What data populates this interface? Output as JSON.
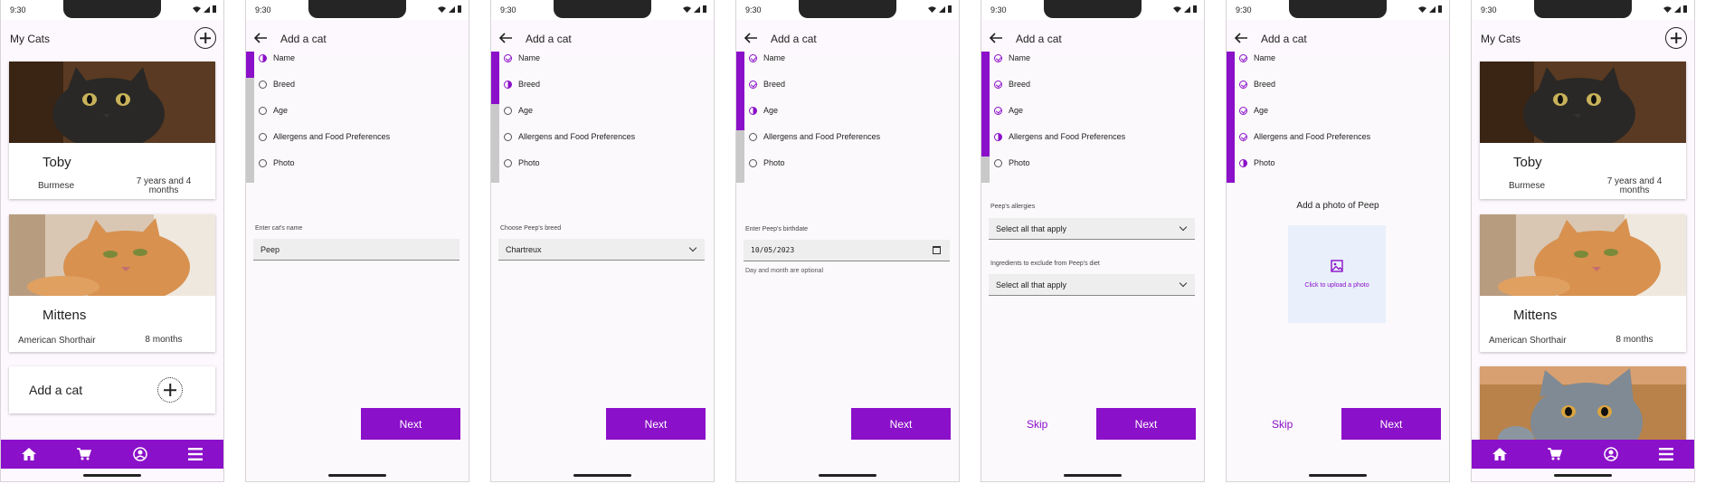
{
  "status": {
    "time": "9:30"
  },
  "colors": {
    "accent": "#8b10c9",
    "nav_bg": "#8b10c9",
    "rail_inactive": "#c9c9c9"
  },
  "list_title": "My Cats",
  "form_title": "Add a cat",
  "cats": [
    {
      "name": "Toby",
      "breed": "Burmese",
      "age": "7 years and 4 months"
    },
    {
      "name": "Mittens",
      "breed": "American Shorthair",
      "age": "8 months"
    }
  ],
  "add_cat_label": "Add a cat",
  "steps": [
    "Name",
    "Breed",
    "Age",
    "Allergens and Food Preferences",
    "Photo"
  ],
  "forms": {
    "name": {
      "label": "Enter cat's name",
      "value": "Peep"
    },
    "breed": {
      "label": "Choose Peep's breed",
      "value": "Chartreux"
    },
    "age": {
      "label": "Enter Peep's birthdate",
      "value": "10/05/2023",
      "hint": "Day and month are optional"
    },
    "allergies": {
      "label": "Peep's allergies",
      "value": "Select all that apply"
    },
    "ingredients": {
      "label": "Ingredients to exclude from Peep's diet",
      "value": "Select all that apply"
    },
    "photo": {
      "title": "Add a photo of Peep",
      "upload": "Click to upload a photo"
    }
  },
  "buttons": {
    "next": "Next",
    "skip": "Skip"
  },
  "nav_icons": [
    "home-icon",
    "cart-icon",
    "profile-icon",
    "menu-icon"
  ]
}
